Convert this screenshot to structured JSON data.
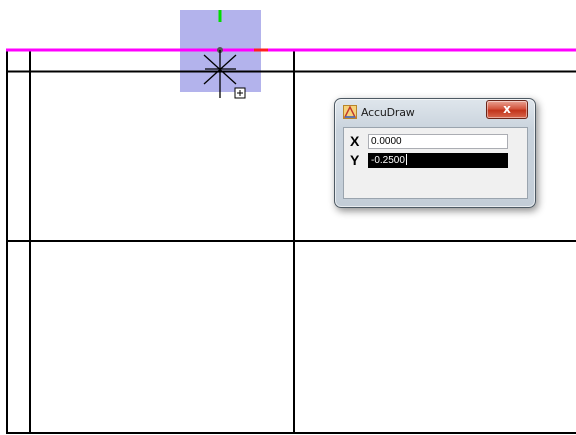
{
  "colors": {
    "background": "#ffffff",
    "grid_lines": "#000000",
    "x_axis_highlight": "#ff00ff",
    "compass_square": "#9a9ae6",
    "y_axis_indicator": "#00dd00",
    "x_axis_indicator": "#ff2020"
  },
  "cursor": {
    "icon": "crosshair-cursor-icon",
    "add_icon": "plus-box-icon"
  },
  "accudraw": {
    "title": "AccuDraw",
    "app_icon": "accudraw-app-icon",
    "close_icon": "close-icon",
    "close_label": "x",
    "x_label": "X",
    "x_value": "0.0000",
    "y_label": "Y",
    "y_value": "-0.2500"
  }
}
